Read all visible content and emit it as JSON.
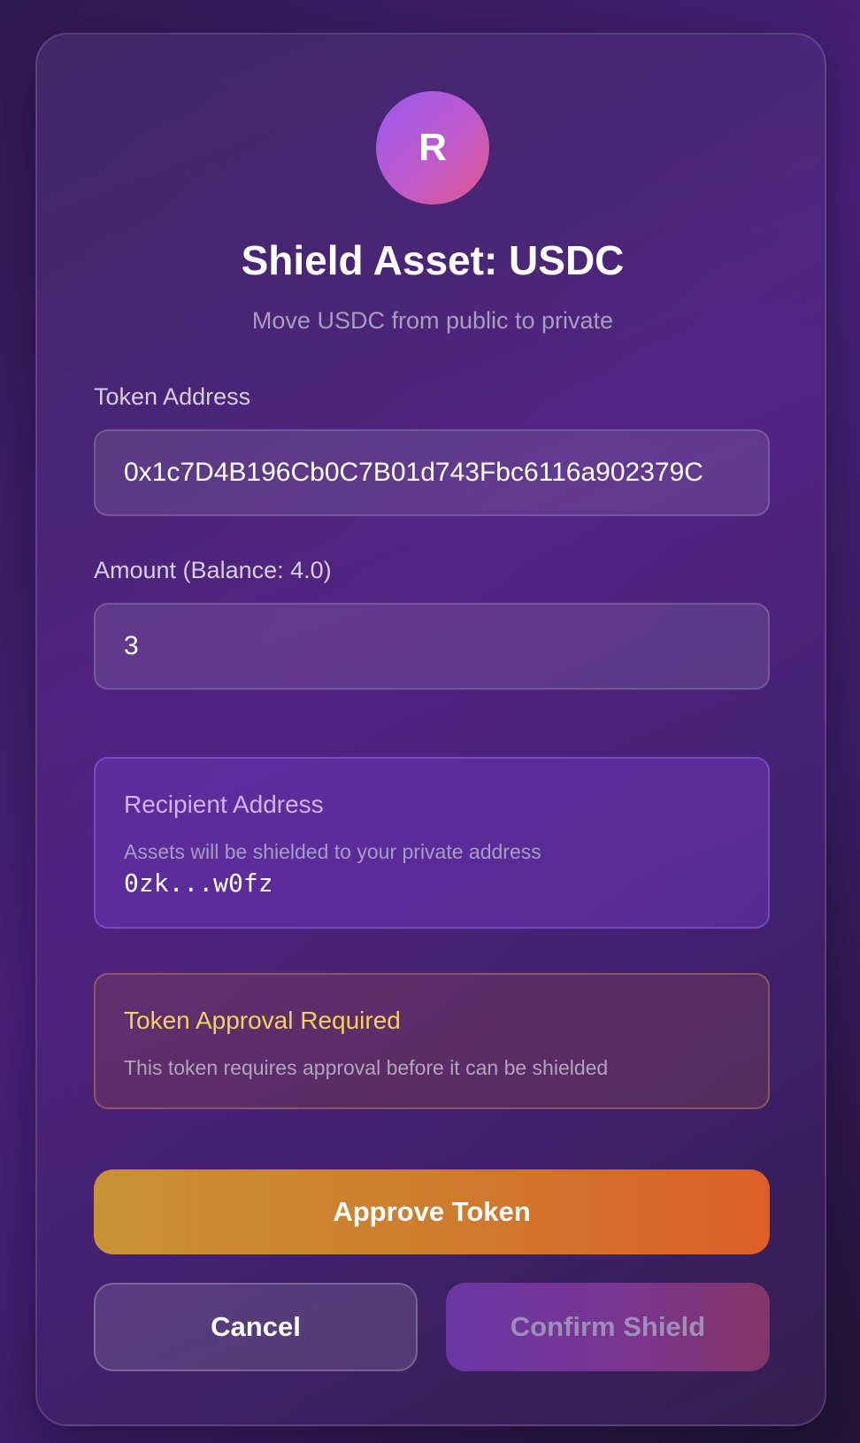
{
  "avatar": {
    "letter": "R"
  },
  "header": {
    "title": "Shield Asset: USDC",
    "subtitle": "Move USDC from public to private"
  },
  "token_address": {
    "label": "Token Address",
    "value": "0x1c7D4B196Cb0C7B01d743Fbc6116a902379C"
  },
  "amount": {
    "label": "Amount (Balance: 4.0)",
    "value": "3"
  },
  "recipient": {
    "title": "Recipient Address",
    "description": "Assets will be shielded to your private address",
    "address": "0zk...w0fz"
  },
  "approval": {
    "title": "Token Approval Required",
    "description": "This token requires approval before it can be shielded"
  },
  "buttons": {
    "approve": "Approve Token",
    "cancel": "Cancel",
    "confirm": "Confirm Shield"
  },
  "colors": {
    "approve_gradient_start": "#c99235",
    "approve_gradient_end": "#dc5f27",
    "approval_title": "#f2d262",
    "recipient_title": "#d2b2f7",
    "avatar_gradient_start": "#9b59f0",
    "avatar_gradient_end": "#e0588a"
  }
}
